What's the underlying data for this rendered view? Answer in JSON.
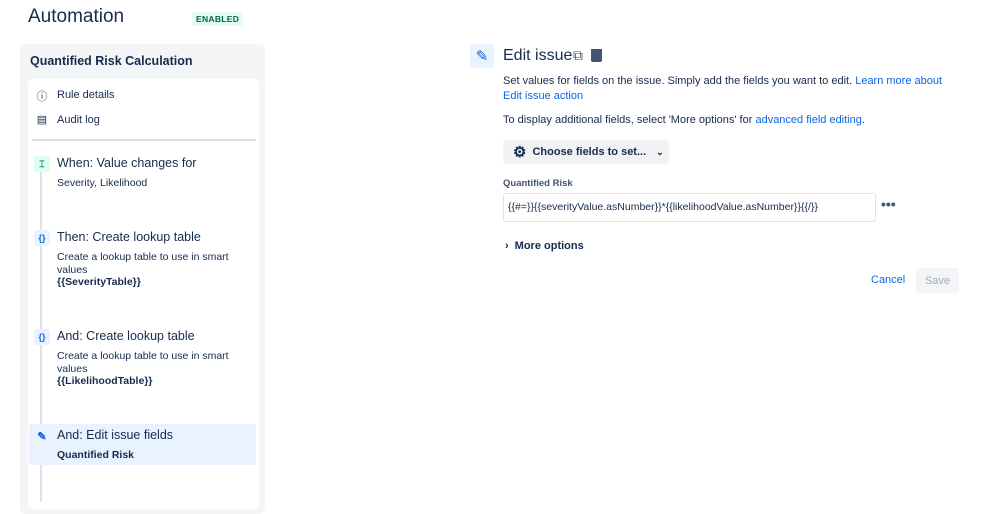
{
  "header": {
    "title": "Automation",
    "status": "ENABLED"
  },
  "sidebar": {
    "rule_name": "Quantified Risk Calculation",
    "nav": [
      {
        "label": "Rule details",
        "icon": "info-icon"
      },
      {
        "label": "Audit log",
        "icon": "audit-log-icon"
      }
    ],
    "steps": [
      {
        "title": "When: Value changes for",
        "desc": "Severity, Likelihood",
        "bold": ""
      },
      {
        "title": "Then: Create lookup table",
        "desc": "Create a lookup table to use in smart values",
        "bold": "{{SeverityTable}}"
      },
      {
        "title": "And: Create lookup table",
        "desc": "Create a lookup table to use in smart values",
        "bold": "{{LikelihoodTable}}"
      },
      {
        "title": "And: Edit issue fields",
        "desc": "",
        "bold": "Quantified Risk"
      }
    ]
  },
  "main": {
    "title": "Edit issue",
    "desc": "Set values for fields on the issue. Simply add the fields you want to edit. ",
    "desc_link": "Learn more about Edit issue action",
    "hint": "To display additional fields, select 'More options' for ",
    "hint_link": "advanced field editing",
    "hint_end": ".",
    "choose_fields": "Choose fields to set...",
    "field_label": "Quantified Risk",
    "field_value": "{{#=}}{{severityValue.asNumber}}*{{likelihoodValue.asNumber}}{{/}}",
    "more_options": "More options",
    "cancel": "Cancel",
    "save": "Save"
  },
  "colors": {
    "accent": "#0c66e4",
    "selected": "#e9f2ff",
    "enabled_bg": "#e3fcef"
  }
}
